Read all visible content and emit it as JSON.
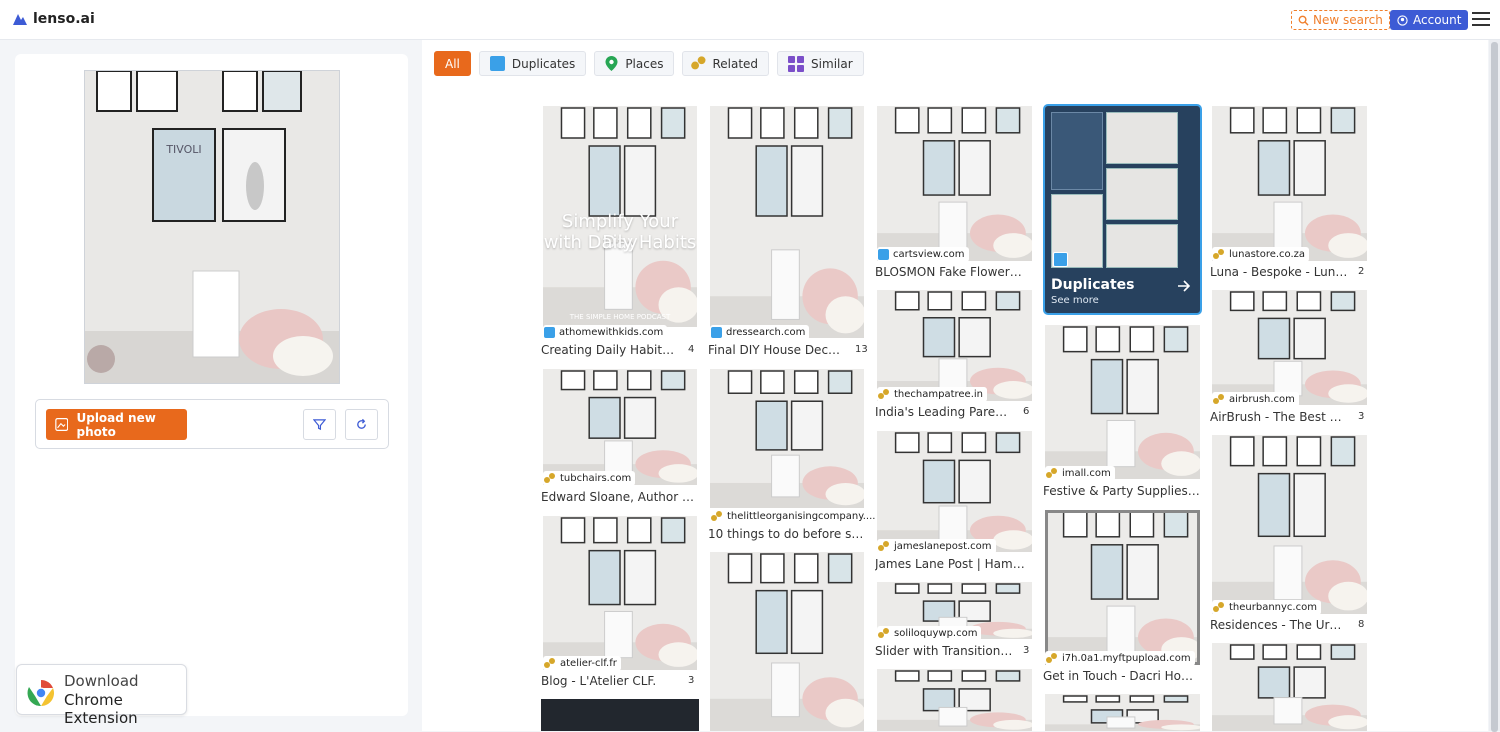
{
  "header": {
    "brand": "lenso.ai",
    "new_search": "New search",
    "account": "Account"
  },
  "left_panel": {
    "upload_label": "Upload new photo",
    "extension_line1": "Download",
    "extension_line2": "Chrome Extension",
    "thumb_tivoli": "TIVOLI"
  },
  "tabs": [
    {
      "label": "All"
    },
    {
      "label": "Duplicates"
    },
    {
      "label": "Places"
    },
    {
      "label": "Related"
    },
    {
      "label": "Similar"
    }
  ],
  "duplicates_card": {
    "title": "Duplicates",
    "see_more": "See more"
  },
  "results": [
    {
      "source": "athomewithkids.com",
      "title": "Creating Daily Habits That...",
      "count": "4",
      "overlay1": "Simplify Your Day",
      "overlay2": "with Daily Habits",
      "podcast": "THE SIMPLE HOME PODCAST"
    },
    {
      "source": "dressearch.com",
      "title": "Final DIY House Decor C...",
      "count": "13"
    },
    {
      "source": "cartsview.com",
      "title": "BLOSMON Fake Flowers in V...",
      "count": ""
    },
    {
      "source": "lunastore.co.za",
      "title": "Luna - Bespoke - Luna - B...",
      "count": "2"
    },
    {
      "source": "thechampatree.in",
      "title": "India's Leading Parenting ...",
      "count": "6"
    },
    {
      "source": "imall.com",
      "title": "Festive & Party Supplies - bu...",
      "count": ""
    },
    {
      "source": "airbrush.com",
      "title": "AirBrush - The Best AI-Po...",
      "count": "3"
    },
    {
      "source": "tubchairs.com",
      "title": "Edward Sloane, Author at Slo...",
      "count": ""
    },
    {
      "source": "thelittleorganisingcompany....",
      "title": "10 things to do before selling...",
      "count": ""
    },
    {
      "source": "jameslanepost.com",
      "title": "James Lane Post | Hamptons...",
      "count": ""
    },
    {
      "source": "theurbannyc.com",
      "title": "Residences - The Urban",
      "count": "8"
    },
    {
      "source": "soliloquywp.com",
      "title": "Slider with Transition Effe...",
      "count": "3"
    },
    {
      "source": "i7h.0a1.myftpupload.com",
      "title": "Get in Touch - Dacri Home",
      "count": ""
    },
    {
      "source": "atelier-clf.fr",
      "title": "Blog - L'Atelier CLF.",
      "count": "3"
    }
  ],
  "colors": {
    "accent": "#e8691c",
    "account_blue": "#3d5bd5",
    "duplicate_blue": "#3aa0e8"
  }
}
